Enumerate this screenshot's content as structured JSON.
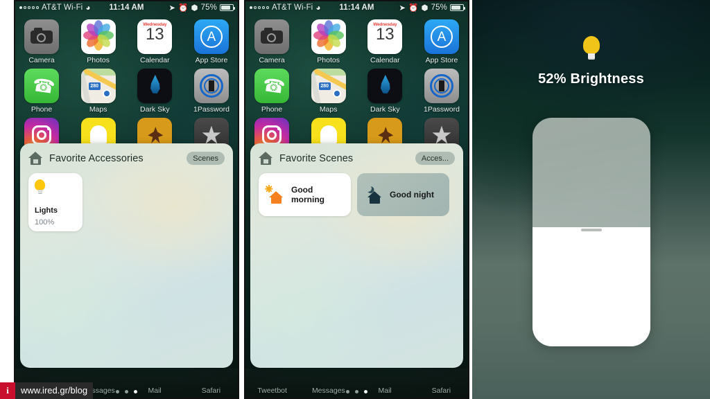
{
  "status_bar": {
    "carrier": "AT&T Wi-Fi",
    "time": "11:14 AM",
    "battery_percent": "75%",
    "signal_dots_filled": 1,
    "signal_dots_total": 5,
    "wifi_icon": "wifi-icon",
    "location_icon": "location-arrow-icon",
    "alarm_icon": "alarm-clock-icon",
    "bluetooth_icon": "bluetooth-icon",
    "battery_icon": "battery-icon"
  },
  "home_screen": {
    "rows": [
      [
        {
          "label": "Camera",
          "icon": "camera-app-icon"
        },
        {
          "label": "Photos",
          "icon": "photos-app-icon"
        },
        {
          "label": "Calendar",
          "icon": "calendar-app-icon",
          "day_of_week": "Wednesday",
          "day_number": "13"
        },
        {
          "label": "App Store",
          "icon": "app-store-app-icon"
        }
      ],
      [
        {
          "label": "Phone",
          "icon": "phone-app-icon"
        },
        {
          "label": "Maps",
          "icon": "maps-app-icon",
          "route_badge": "280"
        },
        {
          "label": "Dark Sky",
          "icon": "dark-sky-app-icon"
        },
        {
          "label": "1Password",
          "icon": "onepassword-app-icon"
        }
      ],
      [
        {
          "label": "",
          "icon": "instagram-app-icon"
        },
        {
          "label": "",
          "icon": "snapchat-app-icon"
        },
        {
          "label": "",
          "icon": "tweetbot-app-icon"
        },
        {
          "label": "",
          "icon": "star-app-icon"
        }
      ]
    ],
    "dock": [
      {
        "label": "Tweetbot"
      },
      {
        "label": "Messages"
      },
      {
        "label": "Mail"
      },
      {
        "label": "Safari"
      }
    ],
    "page_dots_total": 3,
    "page_dots_active_index": 2
  },
  "panels": [
    {
      "id": "accessories",
      "widget": {
        "home_icon": "home-icon",
        "title": "Favorite Accessories",
        "toggle_label": "Scenes",
        "accessories": [
          {
            "name": "Lights",
            "value": "100%",
            "icon": "lightbulb-icon",
            "state": "on"
          }
        ]
      }
    },
    {
      "id": "scenes",
      "widget": {
        "home_icon": "home-icon",
        "title": "Favorite Scenes",
        "toggle_label": "Acces...",
        "scenes": [
          {
            "name": "Good morning",
            "icon": "sun-house-icon",
            "active": true
          },
          {
            "name": "Good night",
            "icon": "moon-house-icon",
            "active": false
          }
        ]
      }
    },
    {
      "id": "brightness",
      "brightness": {
        "icon": "lightbulb-icon",
        "label": "52% Brightness",
        "value_percent": 52,
        "grip": "slider-grip"
      }
    }
  ],
  "watermark": {
    "badge_letter": "i",
    "url": "www.ired.gr/blog"
  },
  "colors": {
    "bulb_yellow": "#fdc70c",
    "brightness_bulb": "#f0c419",
    "scene_orange": "#f58020",
    "scene_navy": "#17333f",
    "pill_bg": "#aebcb4",
    "watermark_red": "#c8102e"
  }
}
